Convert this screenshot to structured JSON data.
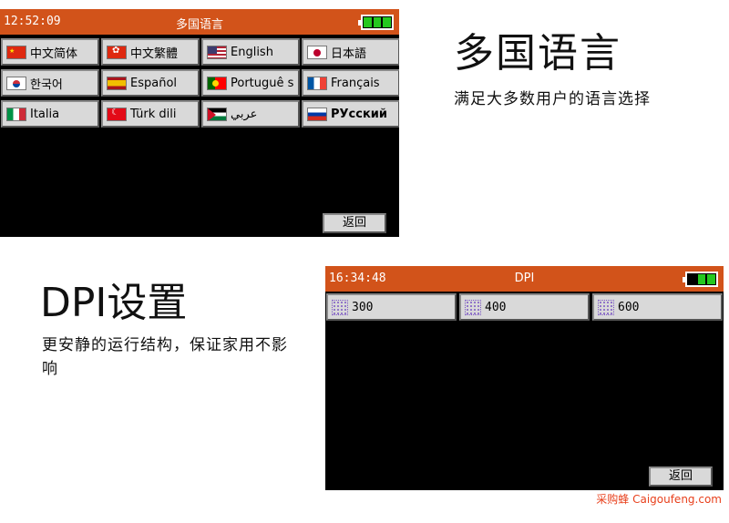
{
  "screen_language": {
    "time": "12:52:09",
    "title": "多国语言",
    "languages": [
      {
        "label": "中文简体",
        "flag": "china-flag"
      },
      {
        "label": "中文繁體",
        "flag": "hongkong-flag"
      },
      {
        "label": "English",
        "flag": "usa-flag"
      },
      {
        "label": "日本語",
        "flag": "japan-flag"
      },
      {
        "label": "한국어",
        "flag": "korea-flag"
      },
      {
        "label": "Español",
        "flag": "spain-flag"
      },
      {
        "label": "Portuguê s",
        "flag": "portugal-flag"
      },
      {
        "label": "Français",
        "flag": "france-flag"
      },
      {
        "label": "Italia",
        "flag": "italy-flag"
      },
      {
        "label": "Türk dili",
        "flag": "turkey-flag"
      },
      {
        "label": "عربي",
        "flag": "arab-flag"
      },
      {
        "label": "PУсский",
        "flag": "russia-flag"
      }
    ],
    "back_label": "返回",
    "battery_color": "#25c81f",
    "header_color": "#d2531a"
  },
  "screen_dpi": {
    "time": "16:34:48",
    "title": "DPI",
    "options": [
      {
        "label": "300"
      },
      {
        "label": "400"
      },
      {
        "label": "600"
      }
    ],
    "back_label": "返回"
  },
  "caption_language": {
    "title": "多国语言",
    "subtitle": "满足大多数用户的语言选择"
  },
  "caption_dpi": {
    "title": "DPI设置",
    "subtitle": "更安静的运行结构，保证家用不影响"
  },
  "watermark": "采购蜂 Caigoufeng.com"
}
